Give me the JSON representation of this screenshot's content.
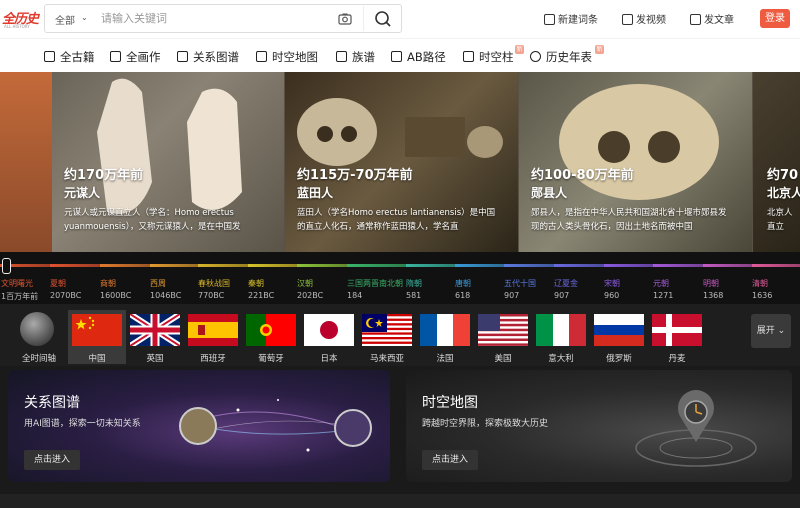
{
  "header": {
    "logo_text": "全历史",
    "logo_sub": "ALL HISTORY",
    "search_scope": "全部",
    "search_placeholder": "请输入关键词",
    "actions": [
      "新建词条",
      "发视频",
      "发文章"
    ],
    "login_label": "登录"
  },
  "nav": {
    "items": [
      {
        "label": "全古籍",
        "badge": ""
      },
      {
        "label": "全画作",
        "badge": ""
      },
      {
        "label": "关系图谱",
        "badge": ""
      },
      {
        "label": "时空地图",
        "badge": ""
      },
      {
        "label": "族谱",
        "badge": ""
      },
      {
        "label": "AB路径",
        "badge": ""
      },
      {
        "label": "时空柱",
        "badge": "新"
      },
      {
        "label": "历史年表",
        "badge": "新"
      }
    ]
  },
  "carousel": {
    "slides": [
      {
        "title": "约170万年前",
        "subtitle": "元谋人",
        "desc": "元谋人或元谋直立人（学名：Homo erectus yuanmouensis），又称元谋猿人，是在中国发"
      },
      {
        "title": "约115万-70万年前",
        "subtitle": "蓝田人",
        "desc": "蓝田人（学名Homo erectus lantianensis）是中国的直立人化石，通常称作蓝田猿人，学名直"
      },
      {
        "title": "约100-80万年前",
        "subtitle": "郧县人",
        "desc": "郧县人，是指在中华人民共和国湖北省十堰市郧县发现的古人类头骨化石，因出土地名而被中国"
      },
      {
        "title": "约70",
        "subtitle": "北京人",
        "desc": "北京人直立人，会"
      }
    ]
  },
  "timeline": {
    "eras": [
      {
        "label": "文明曙光",
        "year": "1百万年前",
        "color": "#e0532f"
      },
      {
        "label": "夏朝",
        "year": "2070BC",
        "color": "#e0532f"
      },
      {
        "label": "商朝",
        "year": "1600BC",
        "color": "#e07a2f"
      },
      {
        "label": "西周",
        "year": "1046BC",
        "color": "#e09a2f"
      },
      {
        "label": "春秋战国",
        "year": "770BC",
        "color": "#d8b42a"
      },
      {
        "label": "秦朝",
        "year": "221BC",
        "color": "#d8c42a"
      },
      {
        "label": "汉朝",
        "year": "202BC",
        "color": "#8cc43a"
      },
      {
        "label": "三国两晋南北朝",
        "year": "184",
        "color": "#3ab46a"
      },
      {
        "label": "隋朝",
        "year": "581",
        "color": "#3ab4a0"
      },
      {
        "label": "唐朝",
        "year": "618",
        "color": "#3a9ad8"
      },
      {
        "label": "五代十国",
        "year": "907",
        "color": "#5a7ae0"
      },
      {
        "label": "辽夏金",
        "year": "907",
        "color": "#6a6ae0"
      },
      {
        "label": "宋朝",
        "year": "960",
        "color": "#8a5ae0"
      },
      {
        "label": "元朝",
        "year": "1271",
        "color": "#a45ad8"
      },
      {
        "label": "明朝",
        "year": "1368",
        "color": "#c45ac0"
      },
      {
        "label": "清朝",
        "year": "1636",
        "color": "#e05a9a"
      }
    ]
  },
  "countries": {
    "items": [
      "全时间轴",
      "中国",
      "英国",
      "西班牙",
      "葡萄牙",
      "日本",
      "马来西亚",
      "法国",
      "美国",
      "意大利",
      "俄罗斯",
      "丹麦"
    ],
    "active": "中国",
    "expand_label": "展开"
  },
  "cards": [
    {
      "title": "关系图谱",
      "desc": "用AI图谱，探索一切未知关系",
      "button": "点击进入"
    },
    {
      "title": "时空地图",
      "desc": "跨越时空界限，探索极致大历史",
      "button": "点击进入"
    }
  ],
  "colors": {
    "accent": "#ef5b3f",
    "brand": "#e03a2d"
  }
}
